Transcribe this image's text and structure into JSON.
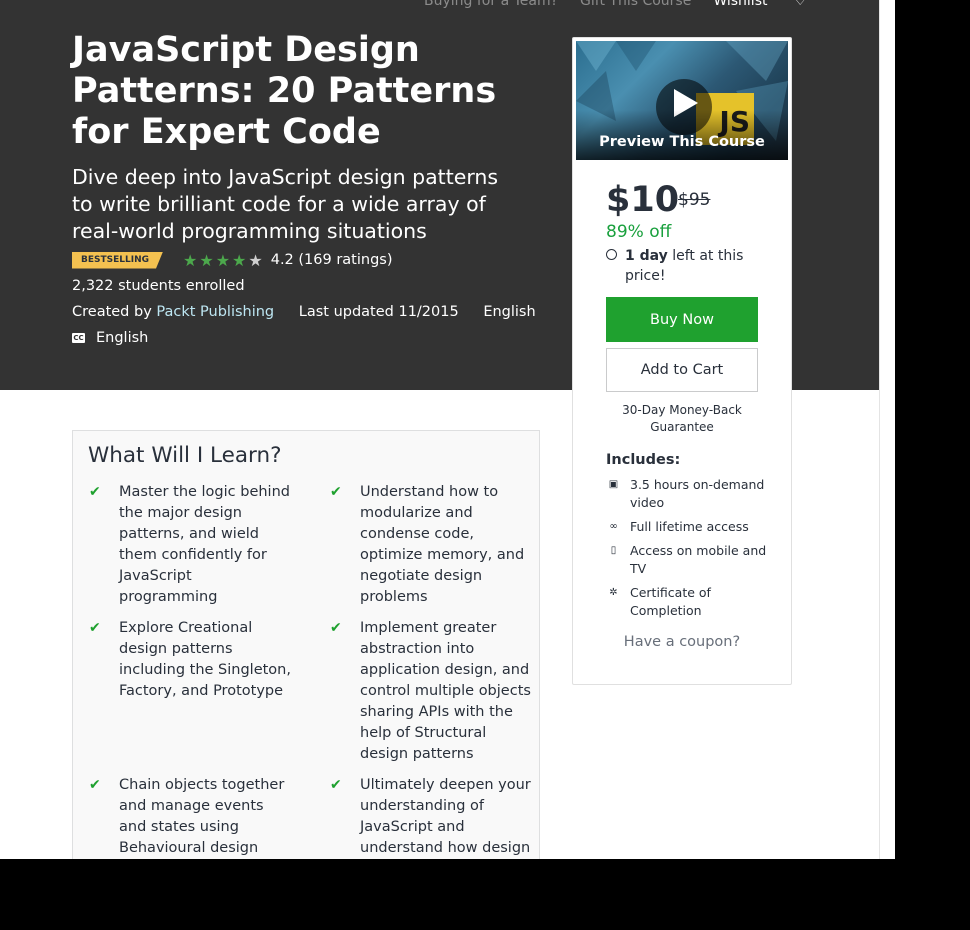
{
  "top_links": [
    "Buying for a Team?",
    "Gift This Course",
    "Wishlist"
  ],
  "course": {
    "title": "JavaScript Design Patterns: 20 Patterns for Expert Code",
    "subtitle": "Dive deep into JavaScript design patterns to write brilliant code for a wide array of real-world programming situations",
    "badge": "BESTSELLING",
    "rating": 4.2,
    "rating_text": "4.2 (169 ratings)",
    "enrolled": "2,322 students enrolled",
    "created_by_label": "Created by",
    "author": "Packt Publishing",
    "last_updated": "Last updated 11/2015",
    "language": "English",
    "cc_icon": "CC",
    "captions": "English"
  },
  "sidebar": {
    "preview_label": "Preview This Course",
    "js_logo": "JS",
    "price": "$10",
    "old_price": "$95",
    "discount": "89% off",
    "timer_bold": "1 day",
    "timer_rest": " left at this price!",
    "buy_label": "Buy Now",
    "cart_label": "Add to Cart",
    "guarantee": "30-Day Money-Back Guarantee",
    "includes_title": "Includes:",
    "includes": [
      {
        "icon": "video-icon",
        "text": "3.5 hours on-demand video"
      },
      {
        "icon": "infinity-icon",
        "text": "Full lifetime access"
      },
      {
        "icon": "mobile-icon",
        "text": "Access on mobile and TV"
      },
      {
        "icon": "certificate-icon",
        "text": "Certificate of Completion"
      }
    ],
    "coupon": "Have a coupon?"
  },
  "learn": {
    "title": "What Will I Learn?",
    "items": [
      "Master the logic behind the major design patterns, and wield them confidently for JavaScript programming",
      "Understand how to modularize and condense code, optimize memory, and negotiate design problems",
      "Explore Creational design patterns including the Singleton, Factory, and Prototype",
      "Implement greater abstraction into application design, and control multiple objects sharing APIs with the help of Structural design patterns",
      "Chain objects together and manage events and states using Behavioural design",
      "Ultimately deepen your understanding of JavaScript and understand how design"
    ]
  },
  "colors": {
    "hero_bg": "#333333",
    "buy_green": "#1fa12f",
    "badge_yellow": "#f4c150",
    "star_green": "#4ca84c",
    "link_blue": "#bde6f2",
    "discount_green": "#19a03d"
  }
}
